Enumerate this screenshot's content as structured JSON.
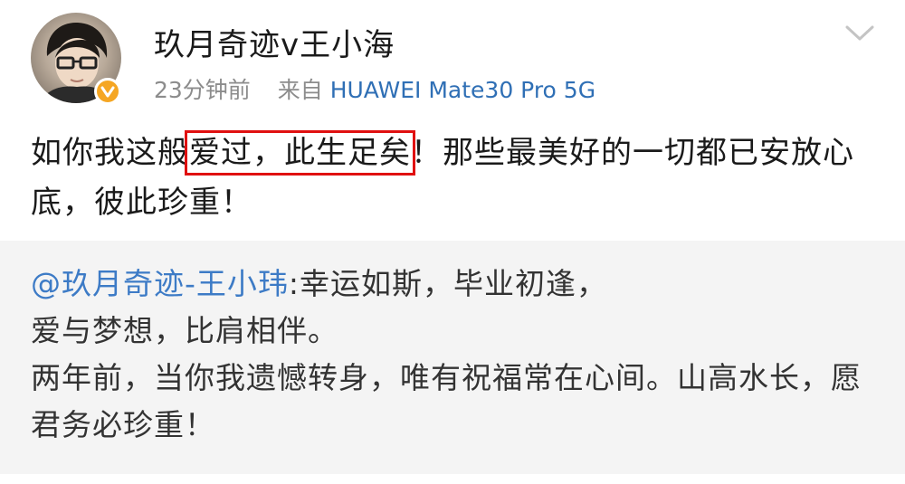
{
  "post": {
    "username": "玖月奇迹v王小海",
    "time": "23分钟前",
    "source_prefix": "来自",
    "device": "HUAWEI Mate30 Pro 5G",
    "content_before": "如你我这般",
    "content_highlight": "爱过，此生足矣",
    "content_after": "！那些最美好的一切都已安放心底，彼此珍重！"
  },
  "repost": {
    "mention": "@玖月奇迹-王小玮",
    "text": ":幸运如斯，毕业初逢，\n爱与梦想，比肩相伴。\n两年前，当你我遗憾转身，唯有祝福常在心间。山高水长，愿君务必珍重！"
  },
  "colors": {
    "link": "#3d7bc6",
    "device": "#2f6fb5",
    "highlight_border": "#e01010",
    "badge": "#f5a623"
  }
}
